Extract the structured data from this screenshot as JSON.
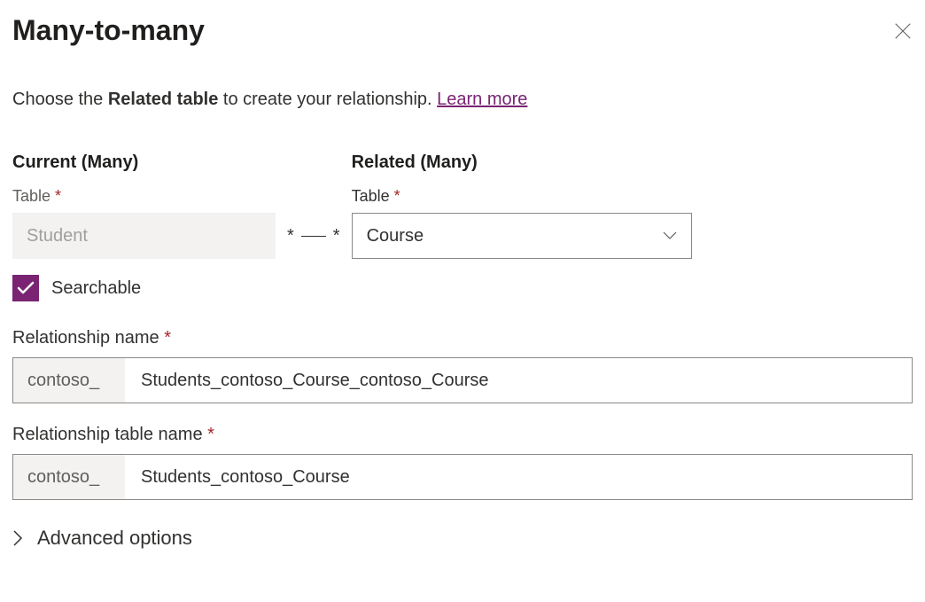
{
  "header": {
    "title": "Many-to-many"
  },
  "intro": {
    "prefix": "Choose the ",
    "bold": "Related table",
    "suffix": " to create your relationship. ",
    "link": "Learn more"
  },
  "current": {
    "section": "Current (Many)",
    "label": "Table",
    "value": "Student"
  },
  "related": {
    "section": "Related (Many)",
    "label": "Table",
    "value": "Course"
  },
  "connector": {
    "left": "*",
    "right": "*"
  },
  "searchable": {
    "label": "Searchable",
    "checked": true
  },
  "relName": {
    "label": "Relationship name",
    "prefix": "contoso_",
    "value": "Students_contoso_Course_contoso_Course"
  },
  "relTableName": {
    "label": "Relationship table name",
    "prefix": "contoso_",
    "value": "Students_contoso_Course"
  },
  "advanced": {
    "label": "Advanced options"
  }
}
